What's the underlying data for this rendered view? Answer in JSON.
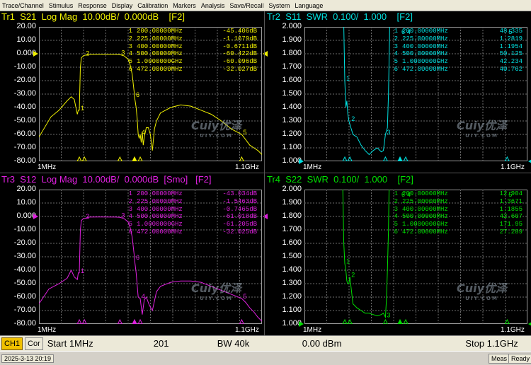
{
  "menu": [
    "Trace/Channel",
    "Stimulus",
    "Response",
    "Display",
    "Calibration",
    "Markers",
    "Analysis",
    "Save/Recall",
    "System",
    "Language"
  ],
  "status": {
    "channel": "CH1",
    "cor": "Cor",
    "start": "Start 1MHz",
    "points": "201",
    "bw": "BW 40k",
    "power": "0.00 dBm",
    "stop": "Stop 1.1GHz"
  },
  "bottom": {
    "datetime": "2025-3-13 20:19",
    "meas": "Meas",
    "ready": "Ready"
  },
  "watermark": {
    "logo": "Cuiy优泽",
    "sub": "UIY.COM"
  },
  "colors": {
    "tr1": "#f0f000",
    "tr2": "#00e0e0",
    "tr3": "#e020e0",
    "tr4": "#00e000",
    "grid": "#6b6b6b"
  },
  "traces": [
    {
      "id": "tr1",
      "title": "Tr1  S21  Log Mag  10.00dB/  0.000dB    [F2]",
      "color": "#f0f000",
      "y_labels": [
        "20.00",
        "10.00",
        "0.000",
        "-10.00",
        "-20.00",
        "-30.00",
        "-40.00",
        "-50.00",
        "-60.00",
        "-70.00",
        "-80.00"
      ],
      "ylim": [
        -80,
        20
      ],
      "x_start": "1MHz",
      "x_stop": "1.1GHz",
      "markers": [
        [
          "1",
          "200.00000MHz",
          "-45.406dB"
        ],
        [
          "2",
          "225.00000MHz",
          "-1.1679dB"
        ],
        [
          "3",
          "400.00000MHz",
          "-0.6711dB"
        ],
        [
          "4",
          "500.00000MHz",
          "-60.422dB"
        ],
        [
          "5",
          "1.0000000GHz",
          "-60.096dB"
        ],
        [
          "6",
          "472.00000MHz",
          "-32.027dB"
        ]
      ],
      "x": [
        1,
        60,
        100,
        140,
        160,
        175,
        190,
        195,
        200,
        205,
        210,
        220,
        225,
        250,
        300,
        380,
        400,
        420,
        440,
        450,
        460,
        470,
        472,
        480,
        485,
        490,
        495,
        500,
        505,
        510,
        515,
        520,
        530,
        540,
        550,
        560,
        570,
        580,
        600,
        650,
        700,
        750,
        800,
        850,
        900,
        950,
        1000,
        1020,
        1040,
        1060,
        1080,
        1100
      ],
      "y": [
        -62,
        -47,
        -42,
        -35,
        -32,
        -34,
        -45,
        -42,
        -42,
        -10,
        -3,
        -1.5,
        -1.2,
        -0.5,
        -0.4,
        -0.5,
        -0.7,
        -1.5,
        -4,
        -8,
        -15,
        -28,
        -32,
        -40,
        -48,
        -60,
        -63,
        -60,
        -66,
        -58,
        -68,
        -62,
        -55,
        -55,
        -60,
        -72,
        -56,
        -50,
        -44,
        -40,
        -38,
        -39,
        -42,
        -45,
        -50,
        -56,
        -60,
        -64,
        -68,
        -70,
        -72,
        -75
      ]
    },
    {
      "id": "tr2",
      "title": "Tr2  S11  SWR  0.100/  1.000    [F2]",
      "color": "#00e0e0",
      "y_labels": [
        "2.000",
        "1.900",
        "1.800",
        "1.700",
        "1.600",
        "1.500",
        "1.400",
        "1.300",
        "1.200",
        "1.100",
        "1.000"
      ],
      "ylim": [
        1,
        2
      ],
      "x_start": "1MHz",
      "x_stop": "1.1GHz",
      "markers": [
        [
          "1",
          "200.00000MHz",
          "48.335"
        ],
        [
          "2",
          "225.00000MHz",
          "1.2819"
        ],
        [
          "3",
          "400.00000MHz",
          "1.1954"
        ],
        [
          "4",
          "500.00000MHz",
          "50.125"
        ],
        [
          "5",
          "1.0000000GHz",
          "42.234"
        ],
        [
          "6",
          "472.00000MHz",
          "40.762"
        ]
      ],
      "x": [
        1,
        150,
        190,
        195,
        200,
        205,
        210,
        215,
        220,
        230,
        240,
        260,
        280,
        300,
        320,
        340,
        360,
        380,
        390,
        400,
        410,
        415,
        420,
        425,
        430,
        600,
        1100
      ],
      "y": [
        2.5,
        2.5,
        2.5,
        2.0,
        1.6,
        1.4,
        1.45,
        1.35,
        1.3,
        1.25,
        1.2,
        1.18,
        1.12,
        1.08,
        1.05,
        1.08,
        1.1,
        1.07,
        1.08,
        1.2,
        1.25,
        1.5,
        1.9,
        2.5,
        2.5,
        2.5,
        2.5
      ]
    },
    {
      "id": "tr3",
      "title": "Tr3  S12  Log Mag  10.00dB/  0.000dB  [Smo]   [F2]",
      "color": "#e020e0",
      "y_labels": [
        "20.00",
        "10.00",
        "0.000",
        "-10.00",
        "-20.00",
        "-30.00",
        "-40.00",
        "-50.00",
        "-60.00",
        "-70.00",
        "-80.00"
      ],
      "ylim": [
        -80,
        20
      ],
      "x_start": "1MHz",
      "x_stop": "1.1GHz",
      "markers": [
        [
          "1",
          "200.00000MHz",
          "-43.034dB"
        ],
        [
          "2",
          "225.00000MHz",
          "-1.5463dB"
        ],
        [
          "3",
          "400.00000MHz",
          "-0.7465dB"
        ],
        [
          "4",
          "500.00000MHz",
          "-61.018dB"
        ],
        [
          "5",
          "1.0000000GHz",
          "-61.205dB"
        ],
        [
          "6",
          "472.00000MHz",
          "-32.025dB"
        ]
      ],
      "x": [
        1,
        50,
        100,
        140,
        160,
        175,
        190,
        195,
        200,
        205,
        210,
        220,
        225,
        250,
        300,
        380,
        400,
        420,
        440,
        450,
        460,
        470,
        472,
        480,
        490,
        500,
        510,
        520,
        530,
        545,
        560,
        580,
        600,
        650,
        700,
        750,
        800,
        850,
        900,
        950,
        1000,
        1020,
        1040,
        1060,
        1080,
        1100
      ],
      "y": [
        -65,
        -54,
        -50,
        -46,
        -40,
        -45,
        -47,
        -42,
        -42,
        -10,
        -3,
        -1.6,
        -1.5,
        -0.5,
        -0.4,
        -0.5,
        -0.7,
        -1.5,
        -4,
        -8,
        -15,
        -28,
        -32,
        -42,
        -60,
        -61,
        -73,
        -62,
        -60,
        -66,
        -70,
        -56,
        -52,
        -49,
        -48,
        -48,
        -49,
        -52,
        -55,
        -58,
        -61,
        -64,
        -68,
        -71,
        -75,
        -78
      ]
    },
    {
      "id": "tr4",
      "title": "Tr4  S22  SWR  0.100/  1.000    [F2]",
      "color": "#00e000",
      "y_labels": [
        "2.000",
        "1.900",
        "1.800",
        "1.700",
        "1.600",
        "1.500",
        "1.400",
        "1.300",
        "1.200",
        "1.100",
        "1.000"
      ],
      "ylim": [
        1,
        2
      ],
      "x_start": "1MHz",
      "x_stop": "1.1GHz",
      "markers": [
        [
          "1",
          "200.00000MHz",
          "12.904"
        ],
        [
          "2",
          "225.00000MHz",
          "1.3671"
        ],
        [
          "3",
          "400.00000MHz",
          "1.1855"
        ],
        [
          "4",
          "500.00000MHz",
          "42.607"
        ],
        [
          "5",
          "1.0000000GHz",
          "171.95"
        ],
        [
          "6",
          "472.00000MHz",
          "27.289"
        ]
      ],
      "x": [
        1,
        150,
        185,
        190,
        195,
        200,
        205,
        210,
        215,
        220,
        225,
        240,
        260,
        280,
        300,
        320,
        340,
        360,
        380,
        390,
        400,
        405,
        410,
        415,
        420,
        425,
        600,
        1100
      ],
      "y": [
        2.5,
        2.5,
        2.5,
        2.0,
        1.6,
        1.45,
        1.4,
        1.32,
        1.3,
        1.3,
        1.35,
        1.15,
        1.12,
        1.1,
        1.08,
        1.08,
        1.07,
        1.06,
        1.07,
        1.08,
        1.05,
        1.18,
        1.4,
        1.7,
        2.2,
        2.5,
        2.5,
        2.5
      ]
    }
  ]
}
